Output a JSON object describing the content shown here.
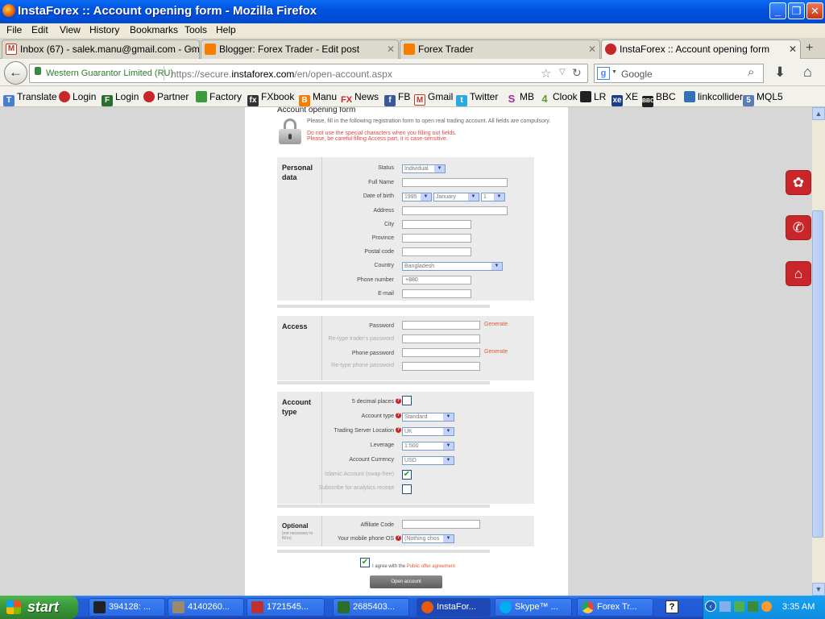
{
  "window": {
    "title": "InstaForex :: Account opening form - Mozilla Firefox",
    "min": "_",
    "max": "❐",
    "close": "✕"
  },
  "menu": [
    "File",
    "Edit",
    "View",
    "History",
    "Bookmarks",
    "Tools",
    "Help"
  ],
  "tabs": [
    {
      "label": "Inbox (67) - salek.manu@gmail.com - Gm...",
      "icon": "gmail-icon",
      "color": "#c23321"
    },
    {
      "label": "Blogger: Forex Trader - Edit post",
      "icon": "blogger-icon",
      "color": "#f57d00"
    },
    {
      "label": "Forex Trader",
      "icon": "blogger-icon",
      "color": "#f57d00"
    },
    {
      "label": "InstaForex :: Account opening form",
      "icon": "instaforex-icon",
      "color": "#c9262a"
    }
  ],
  "nav": {
    "identity": "Western Guarantor Limited (RU)",
    "url_prefix": "https://secure.",
    "url_domain": "instaforex.com",
    "url_path": "/en/open-account.aspx",
    "search_placeholder": "Google"
  },
  "bookmarks": [
    {
      "label": "Translate",
      "icon": "translate-icon",
      "color": "#4a7fd0"
    },
    {
      "label": "Login",
      "icon": "instaforex-icon",
      "color": "#c9262a"
    },
    {
      "label": "Login",
      "icon": "fx-icon",
      "color": "#2b6e2b"
    },
    {
      "label": "Partner",
      "icon": "instaforex-icon",
      "color": "#c9262a"
    },
    {
      "label": "Factory",
      "icon": "factory-icon",
      "color": "#3a9b3a"
    },
    {
      "label": "FXbook",
      "icon": "fxbook-icon",
      "color": "#333"
    },
    {
      "label": "Manu",
      "icon": "blogger-icon",
      "color": "#f57d00"
    },
    {
      "label": "News",
      "icon": "fx-news-icon",
      "color": "#c9262a"
    },
    {
      "label": "FB",
      "icon": "facebook-icon",
      "color": "#3b5998"
    },
    {
      "label": "Gmail",
      "icon": "gmail-icon",
      "color": "#c23321"
    },
    {
      "label": "Twitter",
      "icon": "twitter-icon",
      "color": "#2aa9e0"
    },
    {
      "label": "MB",
      "icon": "mb-icon",
      "color": "#9b2f9b"
    },
    {
      "label": "Clook",
      "icon": "clook-icon",
      "color": "#5a9b2a"
    },
    {
      "label": "LR",
      "icon": "lr-icon",
      "color": "#222"
    },
    {
      "label": "XE",
      "icon": "xe-icon",
      "color": "#1b3d8a"
    },
    {
      "label": "BBC",
      "icon": "bbc-icon",
      "color": "#222"
    },
    {
      "label": "linkcollider",
      "icon": "linkcollider-icon",
      "color": "#3472b8"
    },
    {
      "label": "MQL5",
      "icon": "mql5-icon",
      "color": "#5a7db5"
    }
  ],
  "form": {
    "title": "Account opening form",
    "intro": "Please, fill in the following registration form to open real trading account. All fields are compulsory.",
    "warn1": "Do not use the special characters when you filling out fields.",
    "warn2": "Please, be careful filling Access part, it is case-sensitive.",
    "personal": {
      "heading": "Personal data",
      "status_label": "Status",
      "status_value": "Individual",
      "fullname_label": "Full Name",
      "dob_label": "Date of birth",
      "dob_year": "1995",
      "dob_month": "January",
      "dob_day": "1",
      "address_label": "Address",
      "city_label": "City",
      "province_label": "Province",
      "postal_label": "Postal code",
      "country_label": "Country",
      "country_value": "Bangladesh",
      "phone_label": "Phone number",
      "phone_value": "+880",
      "email_label": "E-mail"
    },
    "access": {
      "heading": "Access",
      "password_label": "Password",
      "retype_label": "Re-type trader's password",
      "phone_password_label": "Phone password",
      "retype_phone_label": "Re-type phone password",
      "generate": "Generate"
    },
    "account": {
      "heading": "Account type",
      "decimal_label": "5 decimal places",
      "type_label": "Account type",
      "type_value": "Standard",
      "server_label": "Trading Server Location",
      "server_value": "UK",
      "leverage_label": "Leverage",
      "leverage_value": "1:500",
      "currency_label": "Account Currency",
      "currency_value": "USD",
      "islamic_label": "Islamic Account (swap-free)",
      "analytics_label": "Subscribe for analytics receipt"
    },
    "optional": {
      "heading": "Optional",
      "sub": "(not necessary to fill in)",
      "affiliate_label": "Affiliate Code",
      "mobile_label": "Your mobile phone OS",
      "mobile_value": "(Nothing chos"
    },
    "agree_prefix": "I agree with the ",
    "agree_link": "Public offer agreement",
    "submit": "Open account"
  },
  "taskbar": {
    "start": "start",
    "items": [
      {
        "label": "394128: ...",
        "icon": "mt4-icon",
        "color": "#222"
      },
      {
        "label": "4140260...",
        "icon": "chart-icon",
        "color": "#9a8a6a"
      },
      {
        "label": "1721545...",
        "icon": "tool-icon",
        "color": "#c03030"
      },
      {
        "label": "2685403...",
        "icon": "fx-icon",
        "color": "#2b6e2b"
      },
      {
        "label": "InstaFor...",
        "icon": "firefox-icon",
        "color": "#e55a0c"
      },
      {
        "label": "Skype™ ...",
        "icon": "skype-icon",
        "color": "#00aff0"
      },
      {
        "label": "Forex Tr...",
        "icon": "chrome-icon",
        "color": "#dd4b39"
      }
    ],
    "clock": "3:35 AM"
  }
}
